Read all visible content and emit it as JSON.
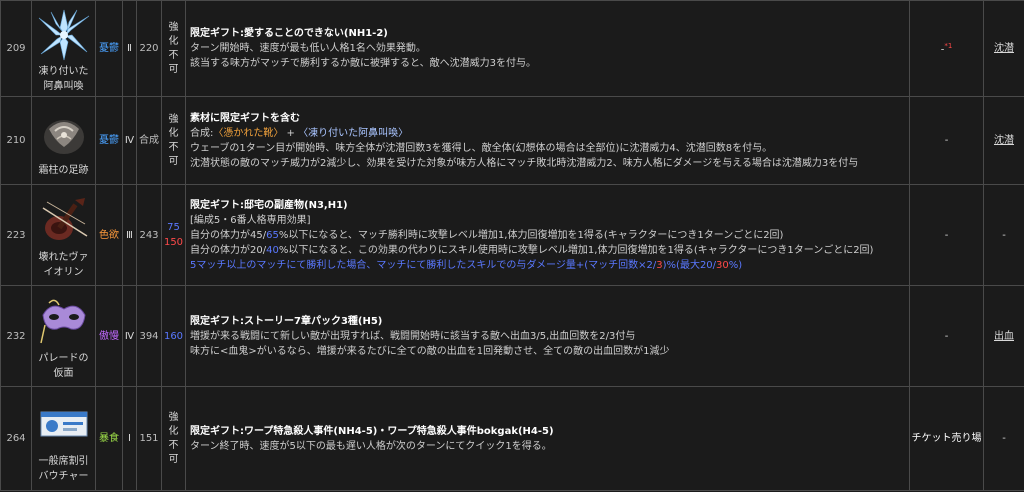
{
  "rows": [
    {
      "id": "209",
      "name_line1": "凍り付いた",
      "name_line2": "阿鼻叫喚",
      "affinity": "憂鬱",
      "tier": "Ⅱ",
      "cost": "220",
      "upgrade": "強化不可",
      "title": "限定ギフト:愛することのできない(NH1-2)",
      "desc1": "ターン開始時、速度が最も低い人格1名へ効果発動。",
      "desc2": "該当する味方がマッチで勝利するか敵に被弾すると、敵へ沈潜威力3を付与。",
      "source": "-",
      "source_sup": "*1",
      "keyword": "沈潜"
    },
    {
      "id": "210",
      "name_line1": "霜柱の足跡",
      "affinity": "憂鬱",
      "tier": "Ⅳ",
      "cost": "合成",
      "upgrade": "強化不可",
      "title": "素材に限定ギフトを含む",
      "combo_prefix": "合成:",
      "combo_a": "〈憑かれた靴〉",
      "combo_plus": " + ",
      "combo_b": "〈凍り付いた阿鼻叫喚〉",
      "desc1": "ウェーブの1ターン目が開始時、味方全体が沈潜回数3を獲得し、敵全体(幻想体の場合は全部位)に沈潜威力4、沈潜回数8を付与。",
      "desc2": "沈潜状態の敵のマッチ威力が2減少し、効果を受けた対象が味方人格にマッチ敗北時沈潜威力2、味方人格にダメージを与える場合は沈潜威力3を付与",
      "source": "-",
      "keyword": "沈潜"
    },
    {
      "id": "223",
      "name_line1": "壊れたヴァ",
      "name_line2": "イオリン",
      "affinity": "色欲",
      "tier": "Ⅲ",
      "cost": "243",
      "upgrade_blue": "75",
      "upgrade_red": "150",
      "title": "限定ギフト:邸宅の副産物(N3,H1)",
      "note": "[編成5・6番人格専用効果]",
      "d1a": "自分の体力が45/",
      "d1b": "65",
      "d1c": "%以下になると、マッチ勝利時に攻撃レベル増加1,体力回復増加を1得る(キャラクターにつき1ターンごとに2回)",
      "d2a": "自分の体力が20/",
      "d2b": "40",
      "d2c": "%以下になると、この効果の代わりにスキル使用時に攻撃レベル増加1,体力回復増加を1得る(キャラクターにつき1ターンごとに2回)",
      "d3a": "5マッチ以上のマッチにて勝利した場合、マッチにて勝利したスキルでの与ダメージ量+(マッチ回数×2/",
      "d3b": "3",
      "d3c": ")%(最大20/",
      "d3d": "30",
      "d3e": "%)",
      "source": "-",
      "keyword": "-"
    },
    {
      "id": "232",
      "name_line1": "パレードの",
      "name_line2": "仮面",
      "affinity": "傲慢",
      "tier": "Ⅳ",
      "cost": "394",
      "upgrade_blue": "160",
      "title": "限定ギフト:ストーリー7章パック3種(H5)",
      "desc1": "増援が来る戦闘にて新しい敵が出現すれば、戦闘開始時に該当する敵へ出血3/5,出血回数を2/3付与",
      "desc2": "味方に<血鬼>がいるなら、増援が来るたびに全ての敵の出血を1回発動させ、全ての敵の出血回数が1減少",
      "source": "-",
      "keyword": "出血"
    },
    {
      "id": "264",
      "name_line1": "一般席割引",
      "name_line2": "バウチャー",
      "affinity": "暴食",
      "tier": "Ⅰ",
      "cost": "151",
      "upgrade": "強化不可",
      "title": "限定ギフト:ワープ特急殺人事件(NH4-5)・ワープ特急殺人事件bokgak(H4-5)",
      "desc1": "ターン終了時、速度が5以下の最も遅い人格が次のターンにてクイック1を得る。",
      "source": "チケット売り場",
      "keyword": "-"
    }
  ]
}
